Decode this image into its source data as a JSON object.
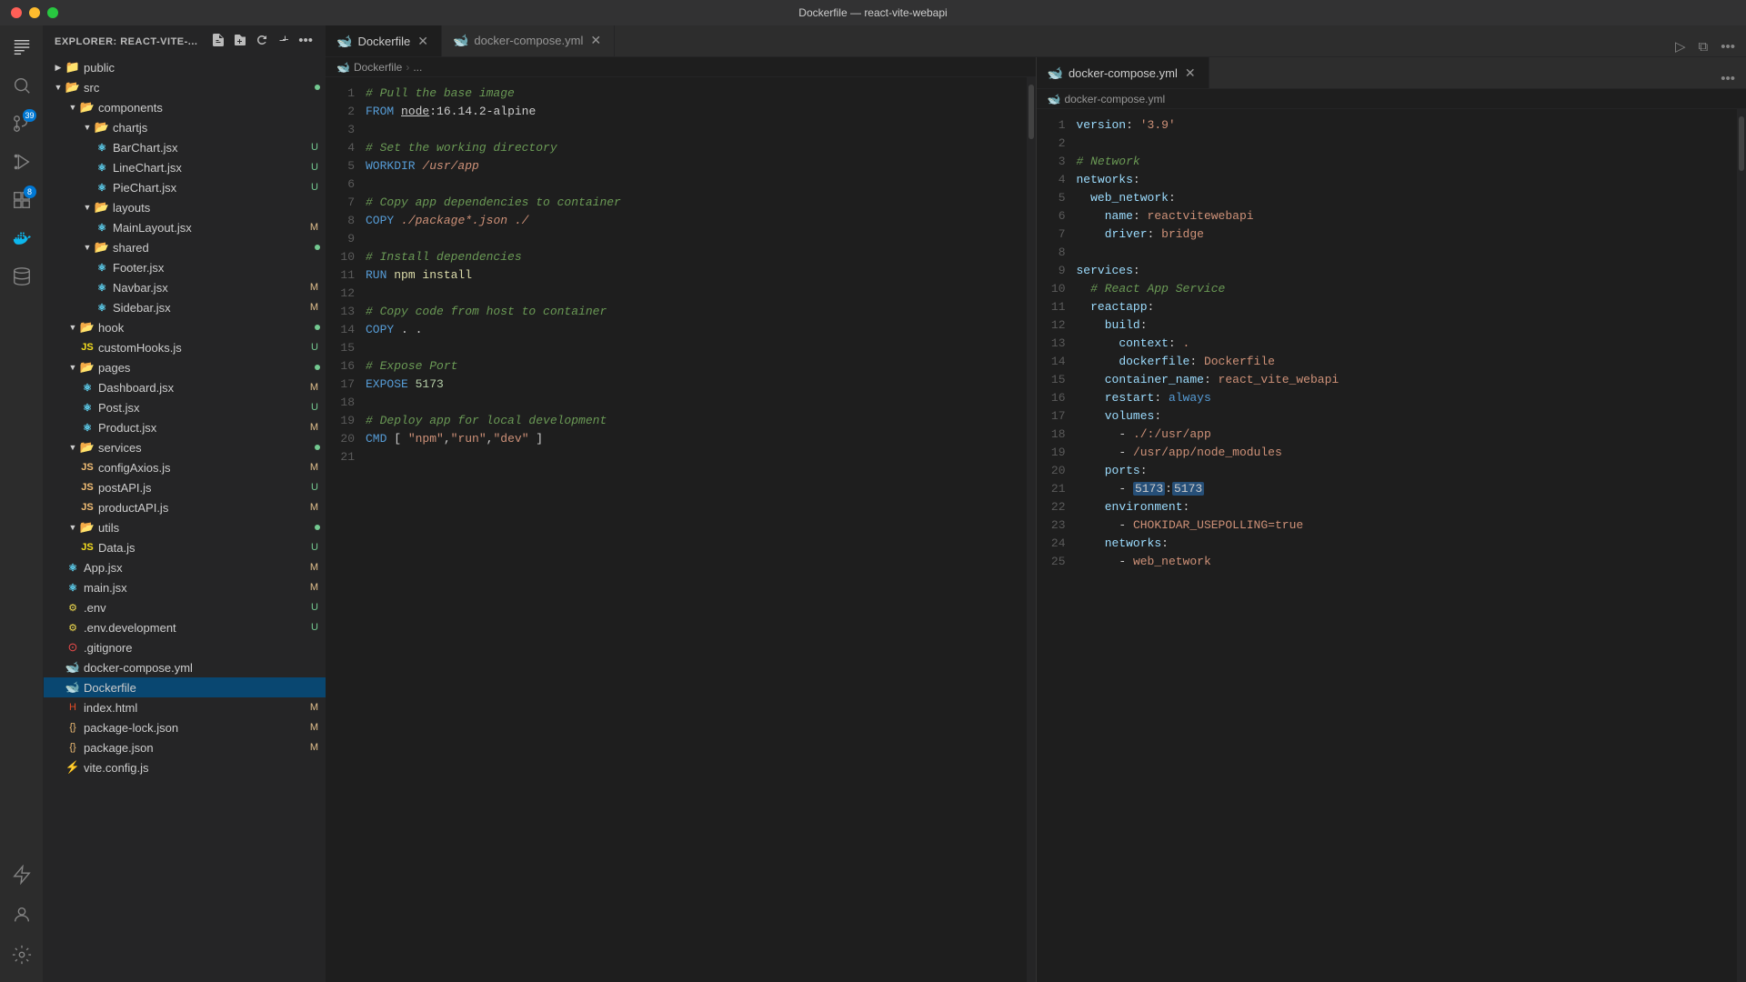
{
  "titlebar": {
    "title": "Dockerfile — react-vite-webapi"
  },
  "sidebar": {
    "title": "EXPLORER: REACT-VITE-...",
    "tree": [
      {
        "id": "public",
        "type": "folder",
        "label": "public",
        "indent": 1,
        "expanded": false,
        "colorClass": "folder-public",
        "badge": ""
      },
      {
        "id": "src",
        "type": "folder",
        "label": "src",
        "indent": 1,
        "expanded": true,
        "colorClass": "folder-src",
        "badge": ""
      },
      {
        "id": "components",
        "type": "folder",
        "label": "components",
        "indent": 2,
        "expanded": true,
        "colorClass": "folder-components",
        "badge": ""
      },
      {
        "id": "chartjs",
        "type": "folder",
        "label": "chartjs",
        "indent": 3,
        "expanded": true,
        "colorClass": "folder-chartjs",
        "badge": ""
      },
      {
        "id": "barchart",
        "type": "file",
        "label": "BarChart.jsx",
        "indent": 4,
        "badge": "U",
        "iconClass": "icon-jsx"
      },
      {
        "id": "linechart",
        "type": "file",
        "label": "LineChart.jsx",
        "indent": 4,
        "badge": "U",
        "iconClass": "icon-jsx"
      },
      {
        "id": "piechart",
        "type": "file",
        "label": "PieChart.jsx",
        "indent": 4,
        "badge": "U",
        "iconClass": "icon-jsx"
      },
      {
        "id": "layouts",
        "type": "folder",
        "label": "layouts",
        "indent": 3,
        "expanded": true,
        "colorClass": "folder-layouts",
        "badge": ""
      },
      {
        "id": "mainlayout",
        "type": "file",
        "label": "MainLayout.jsx",
        "indent": 4,
        "badge": "M",
        "iconClass": "icon-jsx"
      },
      {
        "id": "shared",
        "type": "folder",
        "label": "shared",
        "indent": 3,
        "expanded": true,
        "colorClass": "folder-shared",
        "badge": ""
      },
      {
        "id": "footer",
        "type": "file",
        "label": "Footer.jsx",
        "indent": 4,
        "badge": "",
        "iconClass": "icon-jsx"
      },
      {
        "id": "navbar",
        "type": "file",
        "label": "Navbar.jsx",
        "indent": 4,
        "badge": "M",
        "iconClass": "icon-jsx"
      },
      {
        "id": "sidebar",
        "type": "file",
        "label": "Sidebar.jsx",
        "indent": 4,
        "badge": "M",
        "iconClass": "icon-jsx"
      },
      {
        "id": "hook",
        "type": "folder",
        "label": "hook",
        "indent": 2,
        "expanded": true,
        "colorClass": "folder-hook",
        "badge": ""
      },
      {
        "id": "customhooks",
        "type": "file",
        "label": "customHooks.js",
        "indent": 3,
        "badge": "U",
        "iconClass": "icon-js"
      },
      {
        "id": "pages",
        "type": "folder",
        "label": "pages",
        "indent": 2,
        "expanded": true,
        "colorClass": "folder-pages",
        "badge": ""
      },
      {
        "id": "dashboard",
        "type": "file",
        "label": "Dashboard.jsx",
        "indent": 3,
        "badge": "M",
        "iconClass": "icon-jsx"
      },
      {
        "id": "post",
        "type": "file",
        "label": "Post.jsx",
        "indent": 3,
        "badge": "U",
        "iconClass": "icon-jsx"
      },
      {
        "id": "product",
        "type": "file",
        "label": "Product.jsx",
        "indent": 3,
        "badge": "M",
        "iconClass": "icon-jsx"
      },
      {
        "id": "services",
        "type": "folder",
        "label": "services",
        "indent": 2,
        "expanded": true,
        "colorClass": "folder-services",
        "badge": ""
      },
      {
        "id": "configaxios",
        "type": "file",
        "label": "configAxios.js",
        "indent": 3,
        "badge": "M",
        "iconClass": "icon-js"
      },
      {
        "id": "postapi",
        "type": "file",
        "label": "postAPI.js",
        "indent": 3,
        "badge": "U",
        "iconClass": "icon-js"
      },
      {
        "id": "productapi",
        "type": "file",
        "label": "productAPI.js",
        "indent": 3,
        "badge": "M",
        "iconClass": "icon-js"
      },
      {
        "id": "utils",
        "type": "folder",
        "label": "utils",
        "indent": 2,
        "expanded": true,
        "colorClass": "folder-utils",
        "badge": ""
      },
      {
        "id": "data",
        "type": "file",
        "label": "Data.js",
        "indent": 3,
        "badge": "U",
        "iconClass": "icon-js"
      },
      {
        "id": "app",
        "type": "file",
        "label": "App.jsx",
        "indent": 2,
        "badge": "M",
        "iconClass": "icon-jsx"
      },
      {
        "id": "main",
        "type": "file",
        "label": "main.jsx",
        "indent": 2,
        "badge": "M",
        "iconClass": "icon-jsx"
      },
      {
        "id": "env",
        "type": "file",
        "label": ".env",
        "indent": 1,
        "badge": "U",
        "iconClass": "icon-env"
      },
      {
        "id": "envdev",
        "type": "file",
        "label": ".env.development",
        "indent": 1,
        "badge": "U",
        "iconClass": "icon-env"
      },
      {
        "id": "gitignore",
        "type": "file",
        "label": ".gitignore",
        "indent": 1,
        "badge": "",
        "iconClass": "icon-git"
      },
      {
        "id": "dockercompose",
        "type": "file",
        "label": "docker-compose.yml",
        "indent": 1,
        "badge": "",
        "iconClass": "icon-yaml"
      },
      {
        "id": "dockerfile",
        "type": "file",
        "label": "Dockerfile",
        "indent": 1,
        "badge": "",
        "iconClass": "icon-docker",
        "active": true
      },
      {
        "id": "indexhtml",
        "type": "file",
        "label": "index.html",
        "indent": 1,
        "badge": "M",
        "iconClass": "icon-html"
      },
      {
        "id": "packagelock",
        "type": "file",
        "label": "package-lock.json",
        "indent": 1,
        "badge": "M",
        "iconClass": "icon-json"
      },
      {
        "id": "packagejson",
        "type": "file",
        "label": "package.json",
        "indent": 1,
        "badge": "M",
        "iconClass": "icon-json"
      },
      {
        "id": "viteconfig",
        "type": "file",
        "label": "vite.config.js",
        "indent": 1,
        "badge": "",
        "iconClass": "icon-vite"
      }
    ]
  },
  "tabs": {
    "left": [
      {
        "id": "dockerfile",
        "label": "Dockerfile",
        "active": true,
        "iconClass": "icon-docker"
      },
      {
        "id": "dockercompose",
        "label": "docker-compose.yml",
        "active": false,
        "iconClass": "icon-yaml"
      }
    ]
  },
  "dockerfile": {
    "breadcrumb": [
      "Dockerfile",
      "..."
    ],
    "lines": [
      {
        "num": 1,
        "content": "comment_pull",
        "text": "# Pull the base image"
      },
      {
        "num": 2,
        "content": "from_line",
        "text": "FROM node:16.14.2-alpine"
      },
      {
        "num": 3,
        "content": "blank"
      },
      {
        "num": 4,
        "content": "comment",
        "text": "# Set the working directory"
      },
      {
        "num": 5,
        "content": "workdir",
        "text": "WORKDIR /usr/app"
      },
      {
        "num": 6,
        "content": "blank"
      },
      {
        "num": 7,
        "content": "comment",
        "text": "# Copy app dependencies to container"
      },
      {
        "num": 8,
        "content": "copy_pkg",
        "text": "COPY ./package*.json ./"
      },
      {
        "num": 9,
        "content": "blank"
      },
      {
        "num": 10,
        "content": "comment",
        "text": "# Install dependencies"
      },
      {
        "num": 11,
        "content": "run_npm",
        "text": "RUN npm install"
      },
      {
        "num": 12,
        "content": "blank"
      },
      {
        "num": 13,
        "content": "comment",
        "text": "# Copy code from host to container"
      },
      {
        "num": 14,
        "content": "copy_dot",
        "text": "COPY . ."
      },
      {
        "num": 15,
        "content": "blank"
      },
      {
        "num": 16,
        "content": "comment",
        "text": "# Expose Port"
      },
      {
        "num": 17,
        "content": "expose",
        "text": "EXPOSE 5173"
      },
      {
        "num": 18,
        "content": "blank"
      },
      {
        "num": 19,
        "content": "comment",
        "text": "# Deploy app for local development"
      },
      {
        "num": 20,
        "content": "cmd",
        "text": "CMD [ \"npm\",\"run\",\"dev\" ]"
      },
      {
        "num": 21,
        "content": "blank"
      }
    ]
  },
  "dockercompose": {
    "breadcrumb": [
      "docker-compose.yml"
    ],
    "lines": [
      {
        "num": 1,
        "text": "version: '3.9'"
      },
      {
        "num": 2,
        "text": ""
      },
      {
        "num": 3,
        "text": "# Network"
      },
      {
        "num": 4,
        "text": "networks:"
      },
      {
        "num": 5,
        "text": "  web_network:"
      },
      {
        "num": 6,
        "text": "    name: reactvitewebapi"
      },
      {
        "num": 7,
        "text": "    driver: bridge"
      },
      {
        "num": 8,
        "text": ""
      },
      {
        "num": 9,
        "text": "services:"
      },
      {
        "num": 10,
        "text": "  # React App Service"
      },
      {
        "num": 11,
        "text": "  reactapp:"
      },
      {
        "num": 12,
        "text": "    build:"
      },
      {
        "num": 13,
        "text": "      context: ."
      },
      {
        "num": 14,
        "text": "      dockerfile: Dockerfile"
      },
      {
        "num": 15,
        "text": "    container_name: react_vite_webapi"
      },
      {
        "num": 16,
        "text": "    restart: always"
      },
      {
        "num": 17,
        "text": "    volumes:"
      },
      {
        "num": 18,
        "text": "      - ./:/usr/app"
      },
      {
        "num": 19,
        "text": "      - /usr/app/node_modules"
      },
      {
        "num": 20,
        "text": "    ports:"
      },
      {
        "num": 21,
        "text": "      - 5173:5173"
      },
      {
        "num": 22,
        "text": "    environment:"
      },
      {
        "num": 23,
        "text": "      - CHOKIDAR_USEPOLLING=true"
      },
      {
        "num": 24,
        "text": "    networks:"
      },
      {
        "num": 25,
        "text": "      - web_network"
      }
    ]
  },
  "icons": {
    "explorer": "⬜",
    "search": "🔍",
    "source_control": "⎇",
    "run_debug": "▷",
    "extensions": "⊞",
    "docker": "🐋",
    "database": "⊚",
    "remote": "⚡",
    "testing": "⚗",
    "accounts": "👤",
    "settings": "⚙"
  }
}
